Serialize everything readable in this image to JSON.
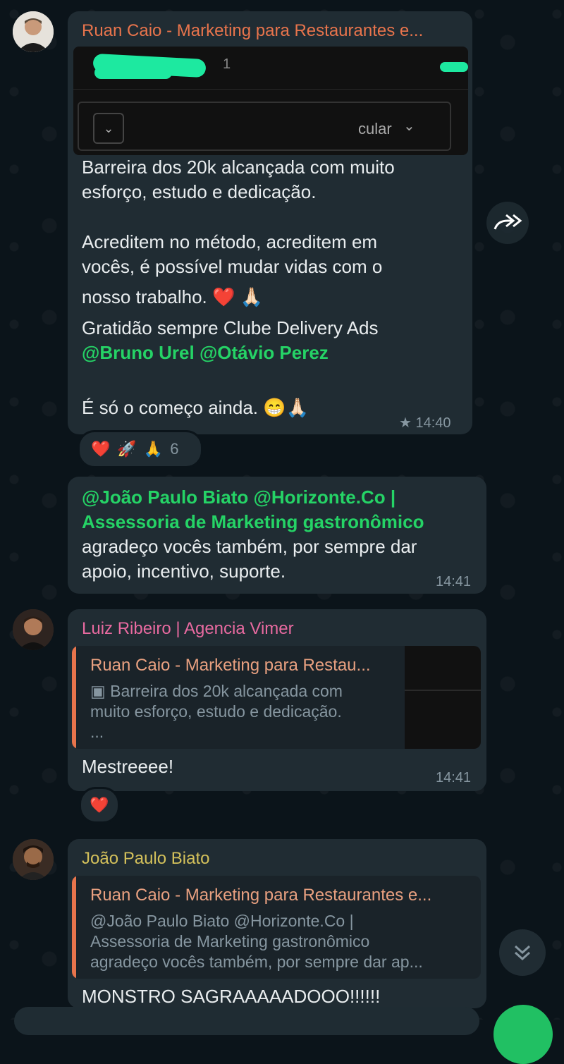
{
  "messages": [
    {
      "sender": "Ruan Caio - Marketing para Restaurantes e...",
      "sender_color": "#e8744c",
      "image_preview": {
        "digit": "1",
        "dropdown_text": "cular"
      },
      "lines": [
        "Barreira dos 20k alcançada com muito",
        "esforço, estudo e dedicação.",
        "",
        "Acreditem no método, acreditem em",
        "vocês, é possível mudar vidas com o",
        "nosso trabalho. ❤️ 🙏🏻",
        "Gratidão sempre Clube Delivery Ads"
      ],
      "mentions_line": [
        "@Bruno Urel",
        "@Otávio Perez"
      ],
      "last_line": "É só o começo ainda. 😁🙏🏻",
      "starred": true,
      "time": "14:40",
      "reactions": {
        "emojis": [
          "❤️",
          "🚀",
          "🙏"
        ],
        "count": "6"
      }
    },
    {
      "mention_lines": [
        "@João Paulo Biato @Horizonte.Co |",
        "Assessoria de Marketing gastronômico"
      ],
      "lines": [
        "agradeço vocês também, por sempre dar",
        "apoio, incentivo, suporte."
      ],
      "time": "14:41"
    },
    {
      "sender": "Luiz Ribeiro | Agencia Vimer",
      "sender_color": "#e86aa0",
      "quote": {
        "title": "Ruan Caio - Marketing para Restau...",
        "icon": "image-icon",
        "lines": [
          "Barreira dos 20k alcançada com",
          "muito esforço, estudo e dedicação.",
          "..."
        ]
      },
      "text": "Mestreeee!",
      "time": "14:41",
      "reactions": {
        "emojis": [
          "❤️"
        ]
      }
    },
    {
      "sender": "João Paulo Biato",
      "sender_color": "#d4c15b",
      "quote": {
        "title": "Ruan Caio - Marketing para Restaurantes e...",
        "lines": [
          "@João Paulo Biato @Horizonte.Co |",
          "Assessoria de Marketing gastronômico",
          "agradeço vocês também, por sempre dar ap..."
        ]
      },
      "text": "MONSTRO SAGRAAAAADOOO!!!!!!"
    }
  ],
  "icons": {
    "forward": "forward-icon",
    "scroll_down": "double-chevron-down-icon",
    "star": "star-icon"
  },
  "colors": {
    "background": "#0b141a",
    "bubble": "#202c33",
    "green": "#25d366"
  }
}
